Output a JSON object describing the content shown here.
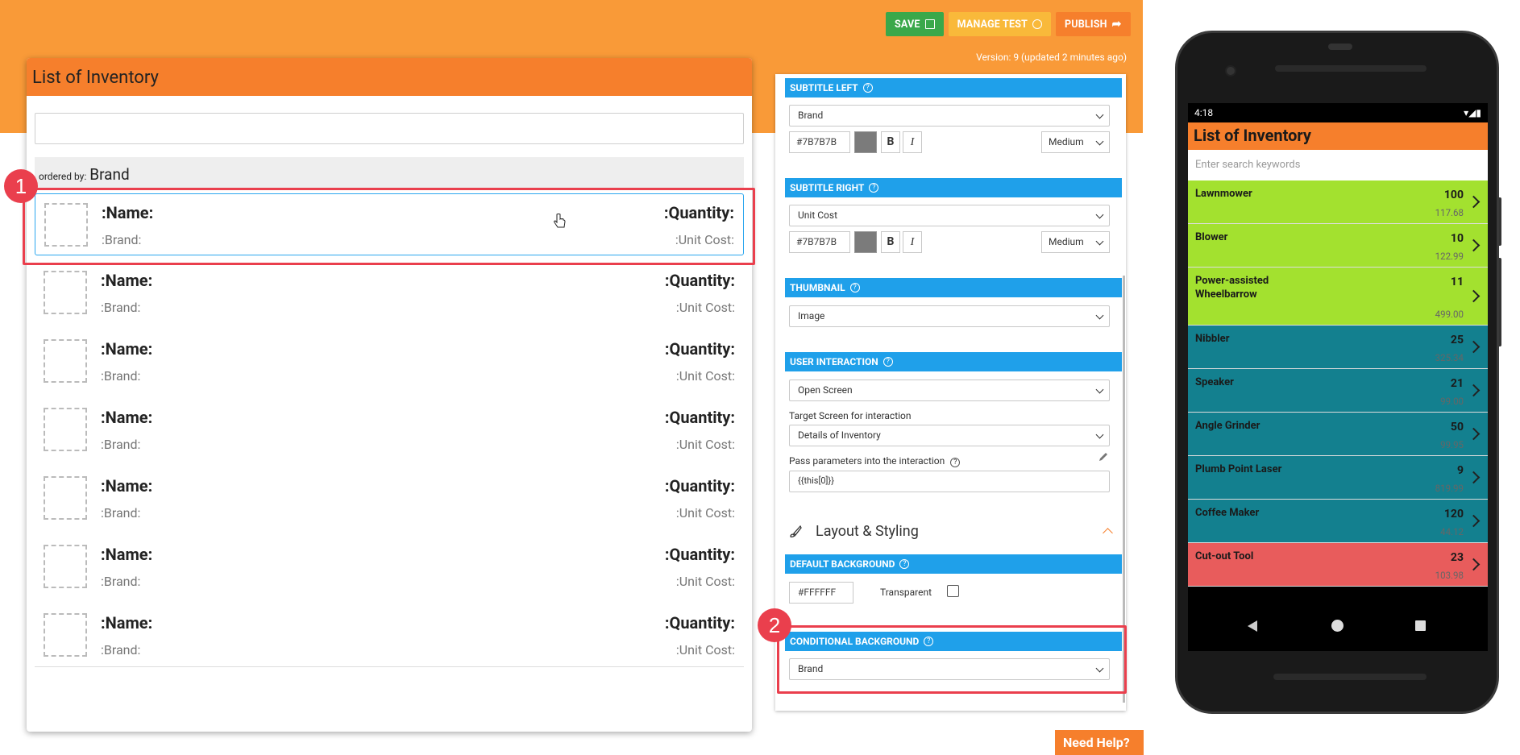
{
  "toolbar": {
    "save": "SAVE",
    "manage": "MANAGE TEST",
    "publish": "PUBLISH",
    "version": "Version: 9 (updated 2 minutes ago)"
  },
  "editor": {
    "title": "List of Inventory",
    "ordered_by_label": "ordered by:",
    "ordered_by_value": "Brand",
    "row": {
      "name": ":Name:",
      "brand": ":Brand:",
      "quantity": ":Quantity:",
      "cost": ":Unit Cost:"
    }
  },
  "callouts": {
    "one": "1",
    "two": "2"
  },
  "props": {
    "subtitle_left": {
      "header": "SUBTITLE LEFT",
      "select": "Brand",
      "color": "#7B7B7B",
      "bold": "B",
      "italic": "I",
      "size": "Medium"
    },
    "subtitle_right": {
      "header": "SUBTITLE RIGHT",
      "select": "Unit Cost",
      "color": "#7B7B7B",
      "bold": "B",
      "italic": "I",
      "size": "Medium"
    },
    "thumbnail": {
      "header": "THUMBNAIL",
      "select": "Image"
    },
    "user_interaction": {
      "header": "USER INTERACTION",
      "select": "Open Screen",
      "target_label": "Target Screen for interaction",
      "target": "Details of Inventory",
      "params_label": "Pass parameters into the interaction",
      "params": "{{this[0]}}"
    },
    "layout_title": "Layout & Styling",
    "default_bg": {
      "header": "DEFAULT BACKGROUND",
      "hex": "#FFFFFF",
      "transparent": "Transparent"
    },
    "conditional_bg": {
      "header": "CONDITIONAL BACKGROUND",
      "select": "Brand"
    },
    "help_glyph": "?"
  },
  "help_button": "Need Help?",
  "phone": {
    "time": "4:18",
    "status_icons": "▾◢▮",
    "title": "List of Inventory",
    "search_placeholder": "Enter search keywords",
    "items": [
      {
        "name": "Lawnmower",
        "qty": "100",
        "cost": "117.68",
        "bg": "#a3e12f"
      },
      {
        "name": "Blower",
        "qty": "10",
        "cost": "122.99",
        "bg": "#a3e12f"
      },
      {
        "name": "Power-assisted Wheelbarrow",
        "qty": "11",
        "cost": "499.00",
        "bg": "#a3e12f"
      },
      {
        "name": "Nibbler",
        "qty": "25",
        "cost": "325.34",
        "bg": "#13808f"
      },
      {
        "name": "Speaker",
        "qty": "21",
        "cost": "99.00",
        "bg": "#13808f"
      },
      {
        "name": "Angle Grinder",
        "qty": "50",
        "cost": "99.95",
        "bg": "#13808f"
      },
      {
        "name": "Plumb Point Laser",
        "qty": "9",
        "cost": "819.99",
        "bg": "#13808f"
      },
      {
        "name": "Coffee Maker",
        "qty": "120",
        "cost": "44.12",
        "bg": "#13808f"
      },
      {
        "name": "Cut-out Tool",
        "qty": "23",
        "cost": "103.98",
        "bg": "#e85c5c"
      }
    ]
  },
  "colors": {
    "orange": "#f99a38",
    "header": "#f67f2c",
    "blue": "#1fa0ea",
    "highlight": "#ea3f4d"
  }
}
